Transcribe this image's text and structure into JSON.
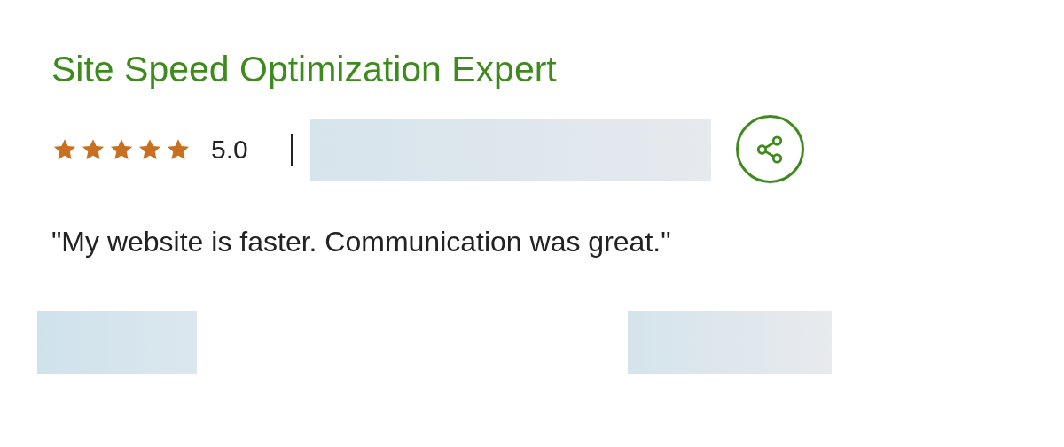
{
  "title": "Site Speed Optimization Expert",
  "rating": {
    "stars": 5,
    "value": "5.0"
  },
  "quote": "\"My website is faster. Communication was great.\""
}
